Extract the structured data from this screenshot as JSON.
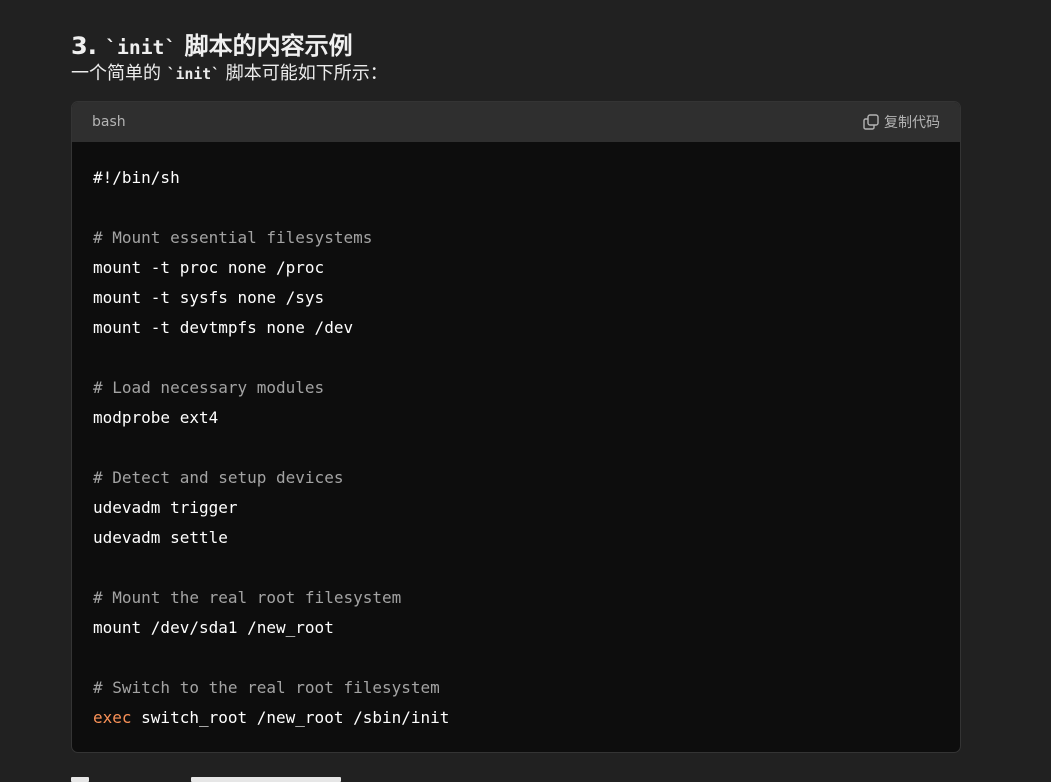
{
  "section": {
    "heading_prefix": "3. ",
    "heading_code": "`init`",
    "heading_suffix": " 脚本的内容示例",
    "intro_prefix": "一个简单的 ",
    "intro_code": "`init`",
    "intro_suffix": " 脚本可能如下所示："
  },
  "code_block": {
    "language": "bash",
    "copy_label": "复制代码",
    "copy_icon": "copy-icon",
    "lines": [
      "#!/bin/sh",
      "",
      "# Mount essential filesystems",
      "mount -t proc none /proc",
      "mount -t sysfs none /sys",
      "mount -t devtmpfs none /dev",
      "",
      "# Load necessary modules",
      "modprobe ext4",
      "",
      "# Detect and setup devices",
      "udevadm trigger",
      "udevadm settle",
      "",
      "# Mount the real root filesystem",
      "mount /dev/sda1 /new_root",
      "",
      "# Switch to the real root filesystem"
    ],
    "last_line_keyword": "exec",
    "last_line_rest": " switch_root /new_root /sbin/init"
  },
  "colors": {
    "page_background": "#212121",
    "code_background": "#0d0d0d",
    "code_header_background": "#2f2f2f",
    "comment": "#a3a3a3",
    "keyword": "#f99157"
  }
}
